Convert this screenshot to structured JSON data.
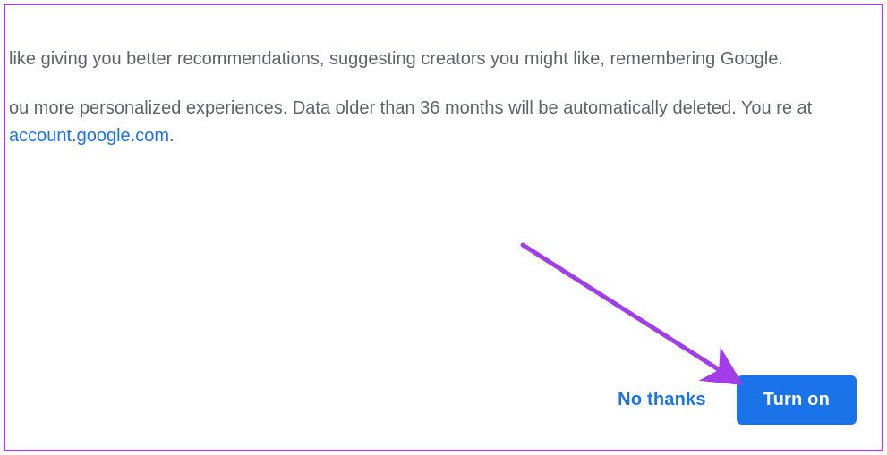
{
  "dialog": {
    "paragraph1_fragment": "like giving you better recommendations, suggesting creators you might like, remembering  Google.",
    "paragraph2_prelink": "ou more personalized experiences. Data older than 36 months will be automatically deleted. You re at ",
    "link_text": "account.google.com",
    "link_period": "."
  },
  "buttons": {
    "no_thanks": "No thanks",
    "turn_on": "Turn on"
  },
  "annotation": {
    "arrow_color": "#a23ee8"
  }
}
